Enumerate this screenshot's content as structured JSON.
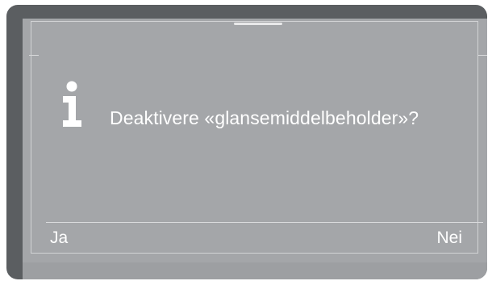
{
  "dialog": {
    "message": "Deaktivere «glansemiddelbeholder»?",
    "icon": "info-icon",
    "buttons": {
      "yes_label": "Ja",
      "no_label": "Nei"
    }
  },
  "colors": {
    "bezel": "#5b5e61",
    "screen": "#a4a6a9",
    "text": "#ffffff"
  }
}
